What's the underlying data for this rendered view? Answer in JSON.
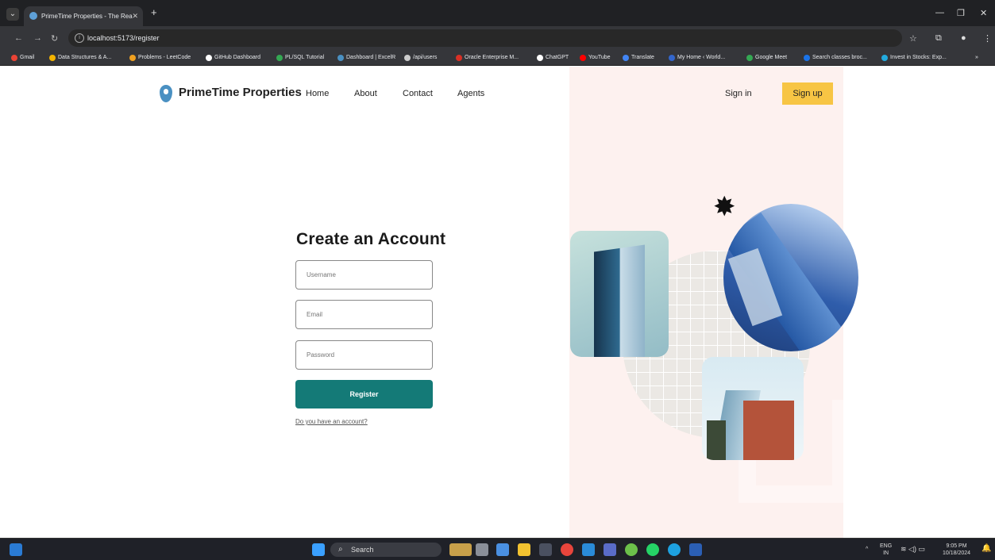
{
  "browser": {
    "tab_title": "PrimeTime Properties - The Rea",
    "new_tab": "+",
    "url": "localhost:5173/register",
    "bookmarks": [
      {
        "label": "Gmail",
        "color": "#ea4335"
      },
      {
        "label": "Data Structures & A...",
        "color": "#f4b400"
      },
      {
        "label": "Problems - LeetCode",
        "color": "#f0a020"
      },
      {
        "label": "GitHub Dashboard",
        "color": "#ffffff"
      },
      {
        "label": "PL/SQL Tutorial",
        "color": "#34a853"
      },
      {
        "label": "Dashboard | ExcelR",
        "color": "#4a90c2"
      },
      {
        "label": "/api/users",
        "color": "#cccccc"
      },
      {
        "label": "Oracle Enterprise M...",
        "color": "#d93025"
      },
      {
        "label": "ChatGPT",
        "color": "#ffffff"
      },
      {
        "label": "YouTube",
        "color": "#ff0000"
      },
      {
        "label": "Translate",
        "color": "#4285f4"
      },
      {
        "label": "My Home ‹ World...",
        "color": "#3366cc"
      },
      {
        "label": "Google Meet",
        "color": "#34a853"
      },
      {
        "label": "Search classes broc...",
        "color": "#1a73e8"
      },
      {
        "label": "Invest in Stocks: Exp...",
        "color": "#22aadd"
      }
    ],
    "more_bookmarks": "»"
  },
  "nav": {
    "brand": "PrimeTime Properties",
    "links": [
      "Home",
      "About",
      "Contact",
      "Agents"
    ],
    "signin": "Sign in",
    "signup": "Sign up"
  },
  "form": {
    "title": "Create an Account",
    "username_placeholder": "Username",
    "email_placeholder": "Email",
    "password_placeholder": "Password",
    "submit": "Register",
    "login_link": "Do you have an account?"
  },
  "taskbar": {
    "search": "Search",
    "lang": "ENG",
    "region": "IN",
    "time": "9:05 PM",
    "date": "10/18/2024"
  },
  "colors": {
    "accent_teal": "#147a77",
    "signup_yellow": "#f7c544",
    "hero_pink": "#fdf1ef",
    "brand_blue": "#4a90c2"
  }
}
